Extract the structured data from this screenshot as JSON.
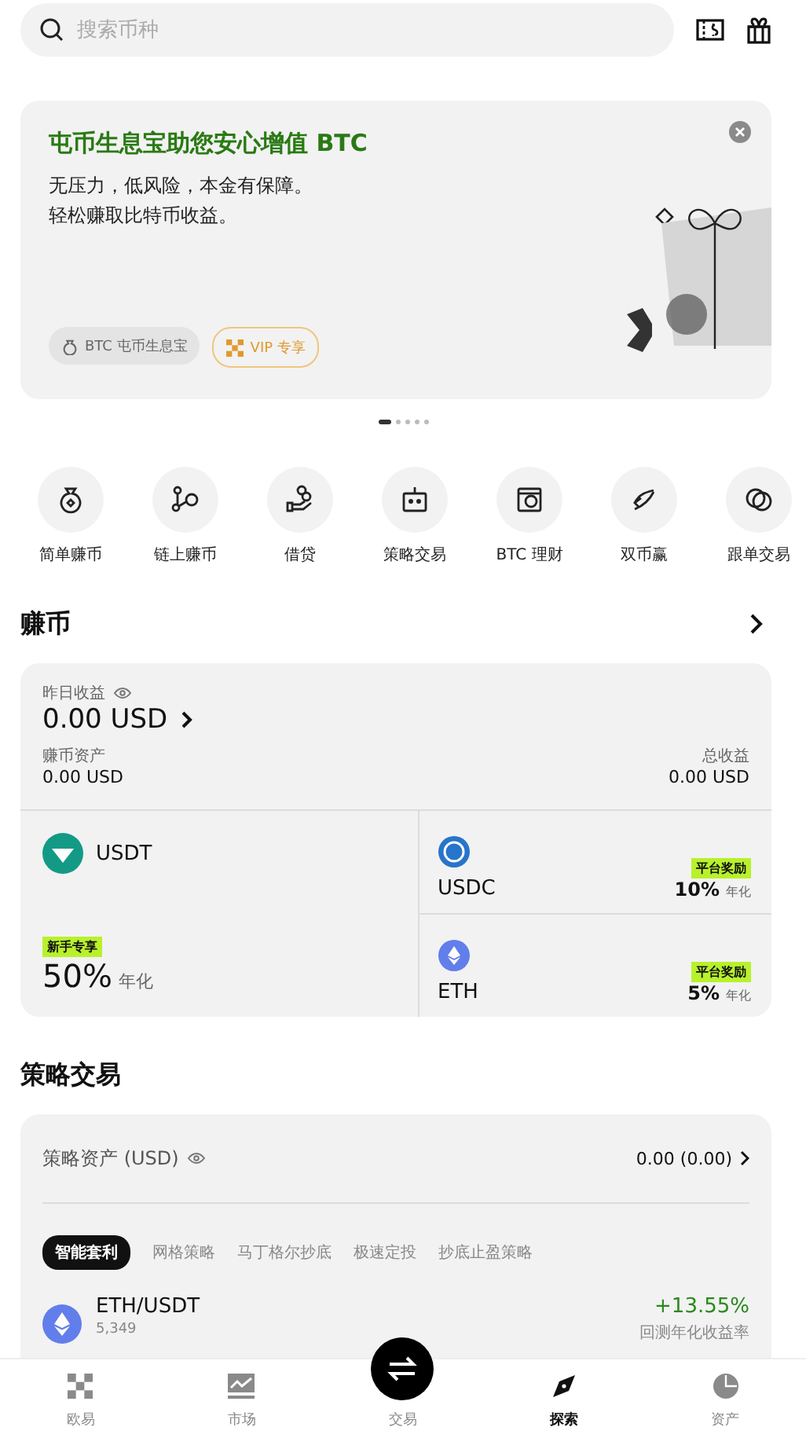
{
  "search": {
    "placeholder": "搜索币种"
  },
  "banner": {
    "title": "屯币生息宝助您安心增值 BTC",
    "lines": [
      "无压力，低风险，本金有保障。",
      "轻松赚取比特币收益。"
    ],
    "tags": [
      {
        "label": "BTC 屯币生息宝",
        "kind": "plain"
      },
      {
        "label": "VIP 专享",
        "kind": "vip"
      }
    ]
  },
  "carousel_dots": [
    {
      "selected": true
    },
    {
      "selected": false
    },
    {
      "selected": false
    },
    {
      "selected": false
    },
    {
      "selected": false
    }
  ],
  "quick_actions": [
    {
      "label": "简单赚币"
    },
    {
      "label": "链上赚币"
    },
    {
      "label": "借贷"
    },
    {
      "label": "策略交易"
    },
    {
      "label": "BTC 理财"
    },
    {
      "label": "双币赢"
    },
    {
      "label": "跟单交易"
    }
  ],
  "earn": {
    "title": "赚币",
    "yesterday_label": "昨日收益",
    "yesterday_value": "0.00 USD",
    "assets_label": "赚币资产",
    "assets_value": "0.00 USD",
    "total_label": "总收益",
    "total_value": "0.00 USD",
    "featured": {
      "kind": "usdt",
      "name": "USDT",
      "badge": "新手专享",
      "rate": "50%",
      "unit": "年化"
    },
    "products": [
      {
        "kind": "usdc",
        "name": "USDC",
        "badge": "平台奖励",
        "rate": "10%",
        "unit": "年化"
      },
      {
        "kind": "eth",
        "name": "ETH",
        "badge": "平台奖励",
        "rate": "5%",
        "unit": "年化"
      }
    ]
  },
  "strategy": {
    "title": "策略交易",
    "assets_label": "策略资产 (USD)",
    "assets_value": "0.00 (0.00)",
    "tabs": [
      {
        "label": "智能套利",
        "selected": true
      },
      {
        "label": "网格策略",
        "selected": false
      },
      {
        "label": "马丁格尔抄底",
        "selected": false
      },
      {
        "label": "极速定投",
        "selected": false
      },
      {
        "label": "抄底止盈策略",
        "selected": false
      }
    ],
    "rows": [
      {
        "kind": "eth",
        "pair": "ETH/USDT",
        "users": "5,349",
        "change": "+13.55%",
        "change_label": "回测年化收益率"
      }
    ]
  },
  "nav": [
    {
      "label": "欧易",
      "kind": "logo",
      "selected": false
    },
    {
      "label": "市场",
      "kind": "chart",
      "selected": false
    },
    {
      "label": "交易",
      "kind": "center",
      "selected": false
    },
    {
      "label": "探索",
      "kind": "compass",
      "selected": true
    },
    {
      "label": "资产",
      "kind": "pie",
      "selected": false
    }
  ]
}
